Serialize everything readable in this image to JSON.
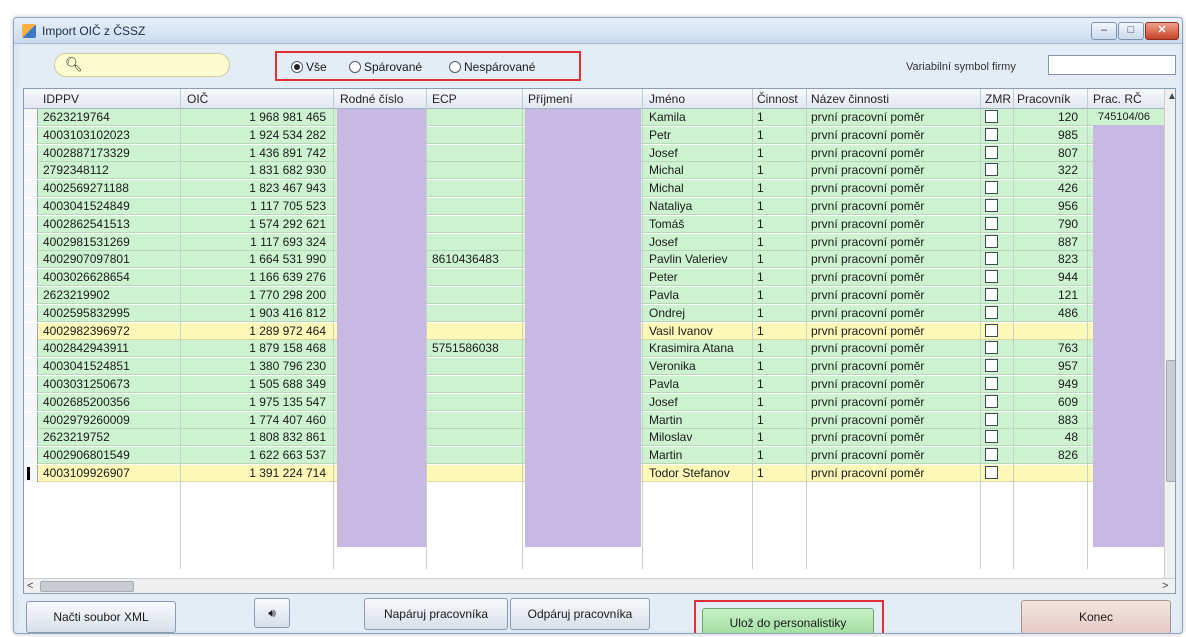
{
  "window": {
    "title": "Import OIČ z ČSSZ"
  },
  "search": {
    "value": "",
    "placeholder": ""
  },
  "filter": {
    "options": [
      "Vše",
      "Spárované",
      "Nespárované"
    ],
    "selected": "Vše"
  },
  "varsym": {
    "label": "Variabilní symbol firmy",
    "value": ""
  },
  "columns": [
    "IDPPV",
    "OIČ",
    "Rodné číslo",
    "ECP",
    "Příjmení",
    "Jméno",
    "Činnost",
    "Název činnosti",
    "ZMR",
    "Pracovník",
    "Prac. RČ"
  ],
  "rows": [
    {
      "idppv": "2623219764",
      "oic": "1 968 981 465",
      "ecp": "",
      "jmeno": "Kamila",
      "cin": "1",
      "nazev": "první pracovní poměr",
      "prac": "120",
      "pracrc": "745104/06",
      "color": "green"
    },
    {
      "idppv": "4003103102023",
      "oic": "1 924 534 282",
      "ecp": "",
      "jmeno": "Petr",
      "cin": "1",
      "nazev": "první pracovní poměr",
      "prac": "985",
      "pracrc": "",
      "color": "green"
    },
    {
      "idppv": "4002887173329",
      "oic": "1 436 891 742",
      "ecp": "",
      "jmeno": "Josef",
      "cin": "1",
      "nazev": "první pracovní poměr",
      "prac": "807",
      "pracrc": "",
      "color": "green"
    },
    {
      "idppv": "2792348112",
      "oic": "1 831 682 930",
      "ecp": "",
      "jmeno": "Michal",
      "cin": "1",
      "nazev": "první pracovní poměr",
      "prac": "322",
      "pracrc": "",
      "color": "green"
    },
    {
      "idppv": "4002569271188",
      "oic": "1 823 467 943",
      "ecp": "",
      "jmeno": "Michal",
      "cin": "1",
      "nazev": "první pracovní poměr",
      "prac": "426",
      "pracrc": "",
      "color": "green"
    },
    {
      "idppv": "4003041524849",
      "oic": "1 117 705 523",
      "ecp": "",
      "jmeno": "Nataliya",
      "cin": "1",
      "nazev": "první pracovní poměr",
      "prac": "956",
      "pracrc": "",
      "color": "green"
    },
    {
      "idppv": "4002862541513",
      "oic": "1 574 292 621",
      "ecp": "",
      "jmeno": "Tomáš",
      "cin": "1",
      "nazev": "první pracovní poměr",
      "prac": "790",
      "pracrc": "",
      "color": "green"
    },
    {
      "idppv": "4002981531269",
      "oic": "1 117 693 324",
      "ecp": "",
      "jmeno": "Josef",
      "cin": "1",
      "nazev": "první pracovní poměr",
      "prac": "887",
      "pracrc": "",
      "color": "green"
    },
    {
      "idppv": "4002907097801",
      "oic": "1 664 531 990",
      "ecp": "8610436483",
      "jmeno": "Pavlin Valeriev",
      "cin": "1",
      "nazev": "první pracovní poměr",
      "prac": "823",
      "pracrc": "",
      "color": "green"
    },
    {
      "idppv": "4003026628654",
      "oic": "1 166 639 276",
      "ecp": "",
      "jmeno": "Peter",
      "cin": "1",
      "nazev": "první pracovní poměr",
      "prac": "944",
      "pracrc": "",
      "color": "green"
    },
    {
      "idppv": "2623219902",
      "oic": "1 770 298 200",
      "ecp": "",
      "jmeno": "Pavla",
      "cin": "1",
      "nazev": "první pracovní poměr",
      "prac": "121",
      "pracrc": "",
      "color": "green"
    },
    {
      "idppv": "4002595832995",
      "oic": "1 903 416 812",
      "ecp": "",
      "jmeno": "Ondrej",
      "cin": "1",
      "nazev": "první pracovní poměr",
      "prac": "486",
      "pracrc": "",
      "color": "green"
    },
    {
      "idppv": "4002982396972",
      "oic": "1 289 972 464",
      "ecp": "",
      "jmeno": "Vasil Ivanov",
      "cin": "1",
      "nazev": "první pracovní poměr",
      "prac": "",
      "pracrc": "",
      "color": "yellow"
    },
    {
      "idppv": "4002842943911",
      "oic": "1 879 158 468",
      "ecp": "5751586038",
      "jmeno": "Krasimira Atana",
      "cin": "1",
      "nazev": "první pracovní poměr",
      "prac": "763",
      "pracrc": "",
      "color": "green"
    },
    {
      "idppv": "4003041524851",
      "oic": "1 380 796 230",
      "ecp": "",
      "jmeno": "Veronika",
      "cin": "1",
      "nazev": "první pracovní poměr",
      "prac": "957",
      "pracrc": "",
      "color": "green"
    },
    {
      "idppv": "4003031250673",
      "oic": "1 505 688 349",
      "ecp": "",
      "jmeno": "Pavla",
      "cin": "1",
      "nazev": "první pracovní poměr",
      "prac": "949",
      "pracrc": "",
      "color": "green"
    },
    {
      "idppv": "4002685200356",
      "oic": "1 975 135 547",
      "ecp": "",
      "jmeno": "Josef",
      "cin": "1",
      "nazev": "první pracovní poměr",
      "prac": "609",
      "pracrc": "",
      "color": "green"
    },
    {
      "idppv": "4002979260009",
      "oic": "1 774 407 460",
      "ecp": "",
      "jmeno": "Martin",
      "cin": "1",
      "nazev": "první pracovní poměr",
      "prac": "883",
      "pracrc": "",
      "color": "green"
    },
    {
      "idppv": "2623219752",
      "oic": "1 808 832 861",
      "ecp": "",
      "jmeno": "Miloslav",
      "cin": "1",
      "nazev": "první pracovní poměr",
      "prac": "48",
      "pracrc": "",
      "color": "green"
    },
    {
      "idppv": "4002906801549",
      "oic": "1 622 663 537",
      "ecp": "",
      "jmeno": "Martin",
      "cin": "1",
      "nazev": "první pracovní poměr",
      "prac": "826",
      "pracrc": "",
      "color": "green"
    },
    {
      "idppv": "4003109926907",
      "oic": "1 391 224 714",
      "ecp": "",
      "jmeno": "Todor Stefanov",
      "cin": "1",
      "nazev": "první pracovní poměr",
      "prac": "",
      "pracrc": "",
      "color": "yellow"
    }
  ],
  "buttons": {
    "load": "Načti soubor XML",
    "pair": "Napáruj pracovníka",
    "unpair": "Odpáruj pracovníka",
    "save": "Ulož do personalistiky",
    "end": "Konec"
  },
  "icons": {
    "app": "app-icon",
    "search": "search-icon",
    "sound": "speaker-icon"
  },
  "colors": {
    "row_paired": "#ccf2cf",
    "row_unpaired": "#fdf8b8",
    "masked": "#c8b9e3",
    "highlight": "#e0303c"
  }
}
